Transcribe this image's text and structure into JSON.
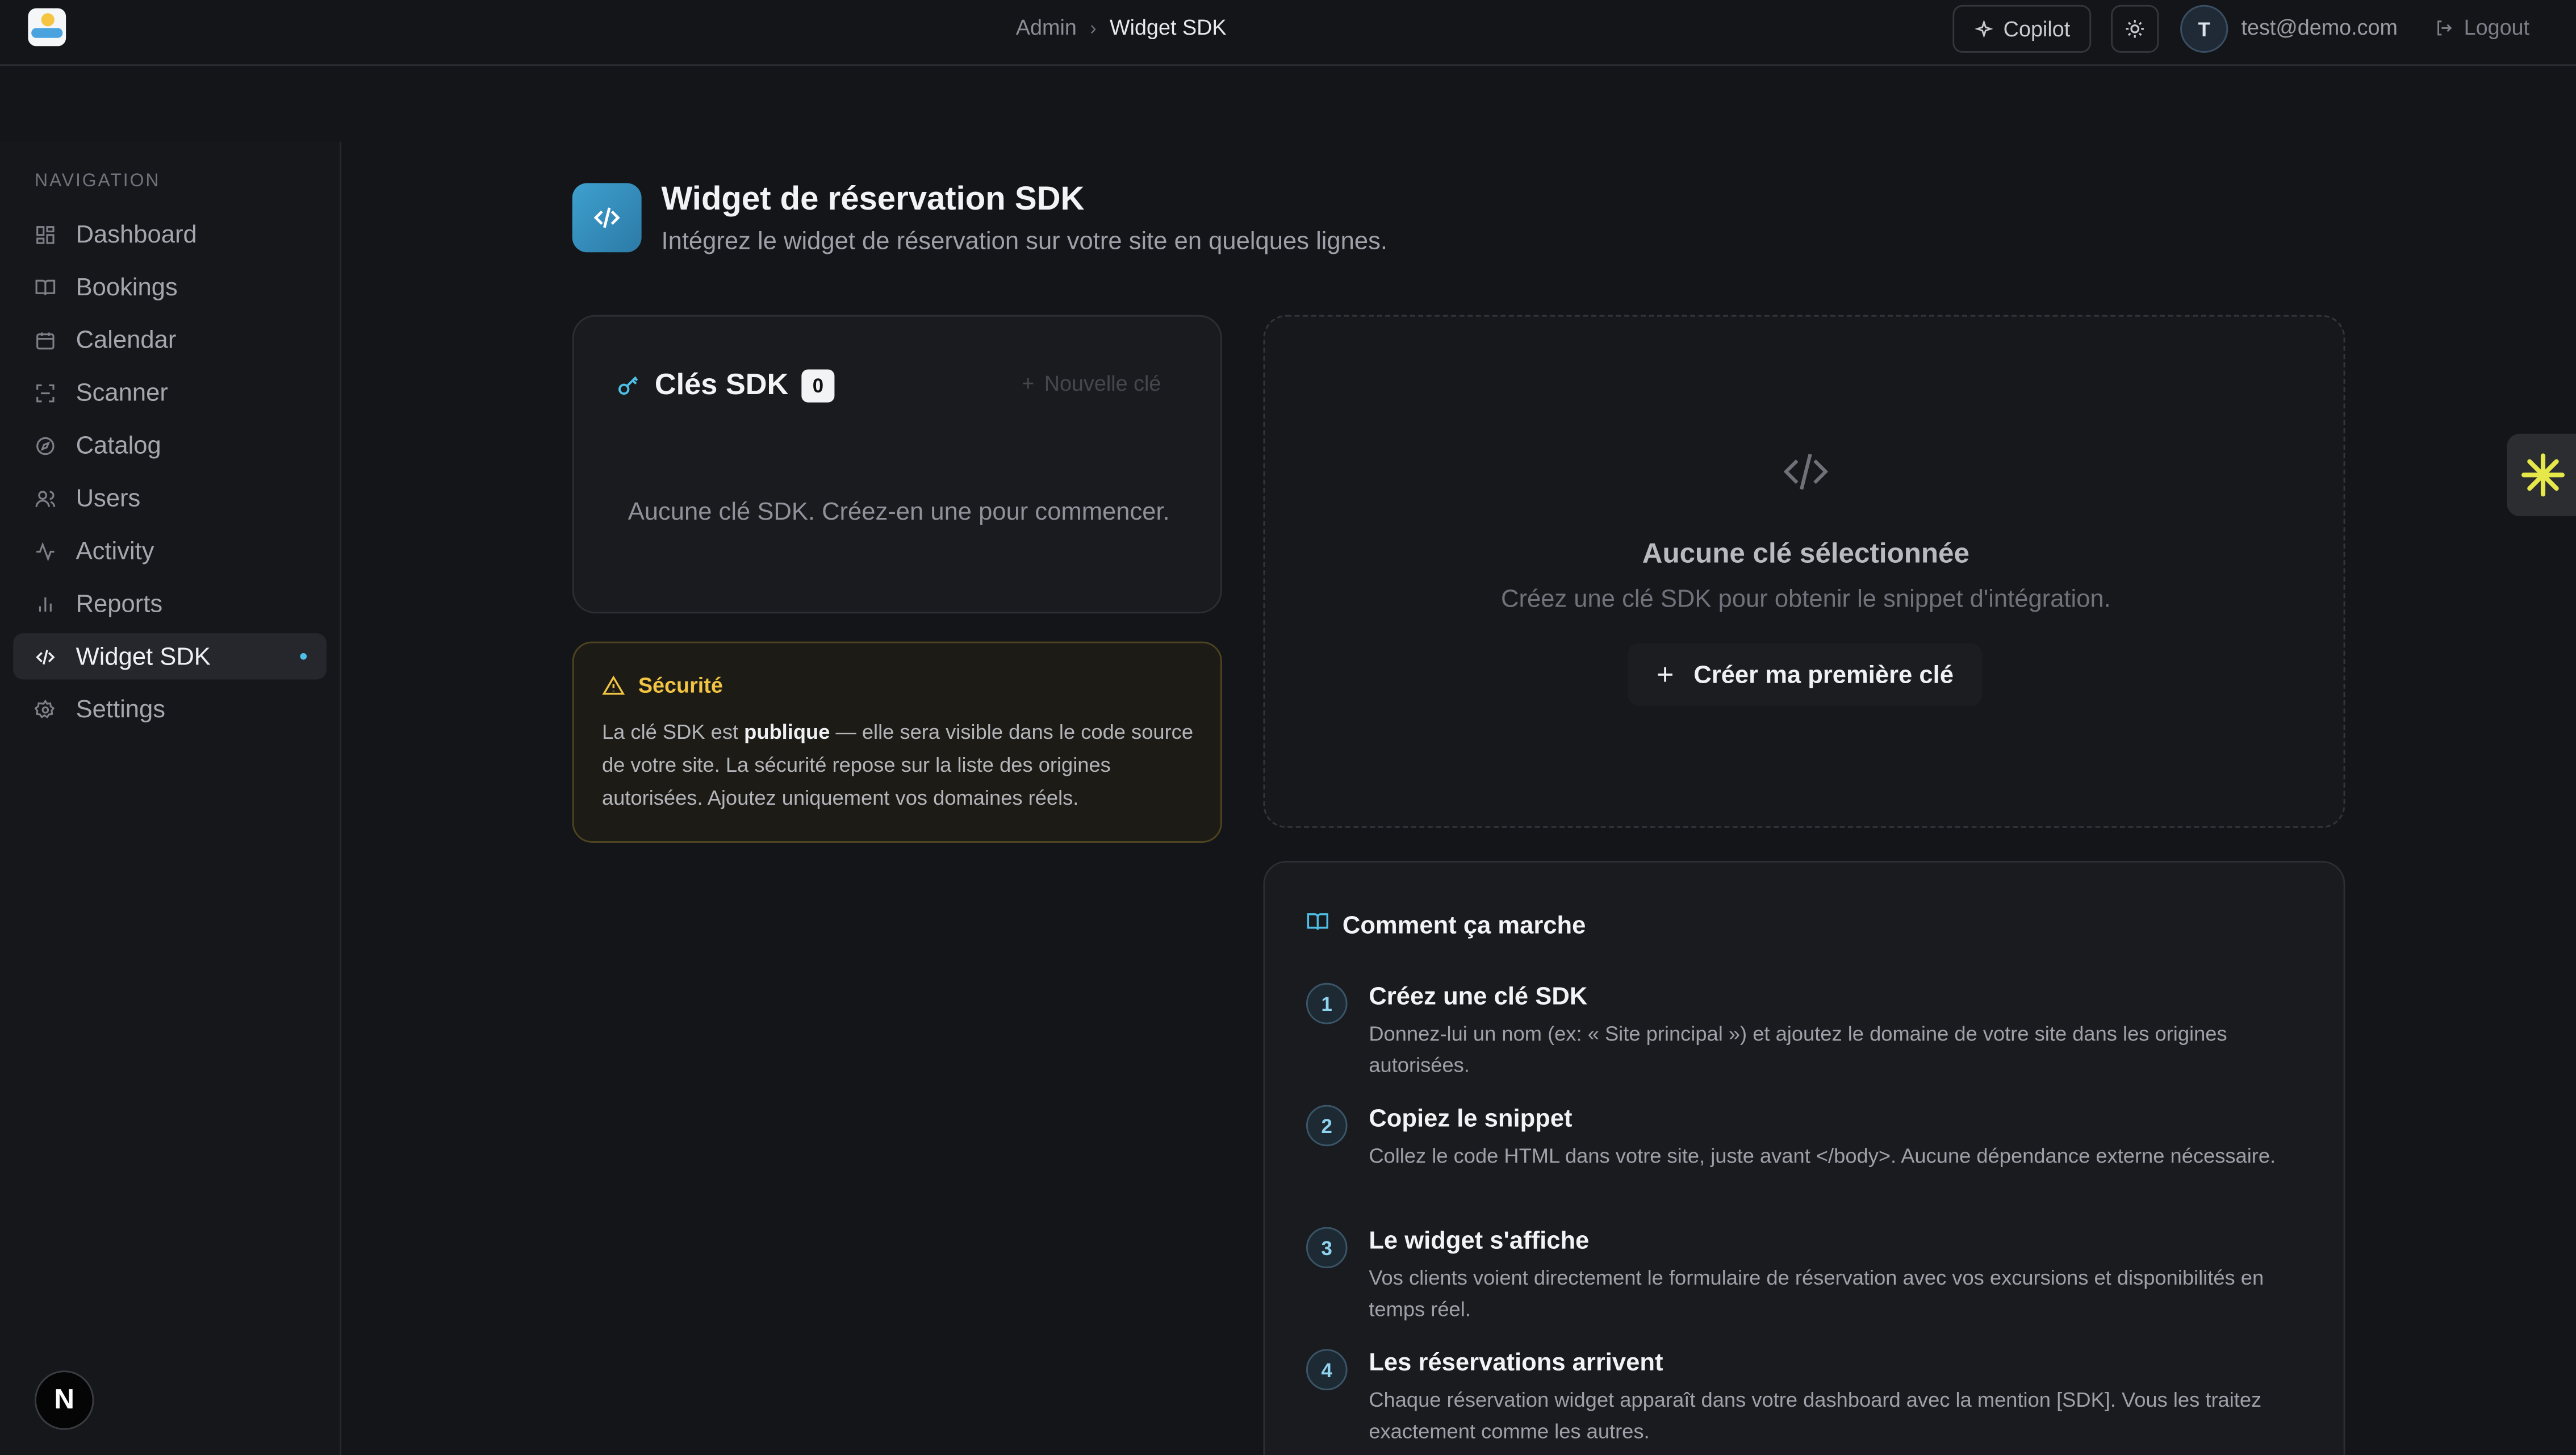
{
  "header": {
    "breadcrumb": [
      "Admin",
      "Widget SDK"
    ],
    "copilot_label": "Copilot",
    "user_initial": "T",
    "user_email": "test@demo.com",
    "logout_label": "Logout"
  },
  "sidebar": {
    "section_title": "NAVIGATION",
    "items": [
      {
        "label": "Dashboard",
        "icon": "dashboard-icon"
      },
      {
        "label": "Bookings",
        "icon": "book-icon"
      },
      {
        "label": "Calendar",
        "icon": "calendar-icon"
      },
      {
        "label": "Scanner",
        "icon": "scan-icon"
      },
      {
        "label": "Catalog",
        "icon": "compass-icon"
      },
      {
        "label": "Users",
        "icon": "users-icon"
      },
      {
        "label": "Activity",
        "icon": "activity-icon"
      },
      {
        "label": "Reports",
        "icon": "bar-chart-icon"
      },
      {
        "label": "Widget SDK",
        "icon": "code-icon",
        "active": true
      },
      {
        "label": "Settings",
        "icon": "gear-icon"
      }
    ],
    "bottom_badge": "N"
  },
  "page": {
    "title": "Widget de réservation SDK",
    "subtitle": "Intégrez le widget de réservation sur votre site en quelques lignes."
  },
  "keys": {
    "title": "Clés SDK",
    "count": "0",
    "new_key_label": "Nouvelle clé",
    "empty_text": "Aucune clé SDK. Créez-en une pour commencer."
  },
  "security": {
    "title": "Sécurité",
    "text_before": "La clé SDK est ",
    "text_bold": "publique",
    "text_after": " — elle sera visible dans le code source de votre site. La sécurité repose sur la liste des origines autorisées. Ajoutez uniquement vos domaines réels."
  },
  "selection": {
    "title": "Aucune clé sélectionnée",
    "subtitle": "Créez une clé SDK pour obtenir le snippet d'intégration.",
    "create_label": "Créer ma première clé"
  },
  "how": {
    "title": "Comment ça marche",
    "steps": [
      {
        "num": "1",
        "title": "Créez une clé SDK",
        "desc": "Donnez-lui un nom (ex: « Site principal ») et ajoutez le domaine de votre site dans les origines autorisées."
      },
      {
        "num": "2",
        "title": "Copiez le snippet",
        "desc": "Collez le code HTML dans votre site, juste avant </body>. Aucune dépendance externe nécessaire."
      },
      {
        "num": "3",
        "title": "Le widget s'affiche",
        "desc": "Vos clients voient directement le formulaire de réservation avec vos excursions et disponibilités en temps réel."
      },
      {
        "num": "4",
        "title": "Les réservations arrivent",
        "desc": "Chaque réservation widget apparaît dans votre dashboard avec la mention [SDK]. Vous les traitez exactement comme les autres."
      }
    ]
  },
  "colors": {
    "accent": "#4ec0e6",
    "warning": "#f2c443",
    "widget_star": "#e6e84a"
  }
}
